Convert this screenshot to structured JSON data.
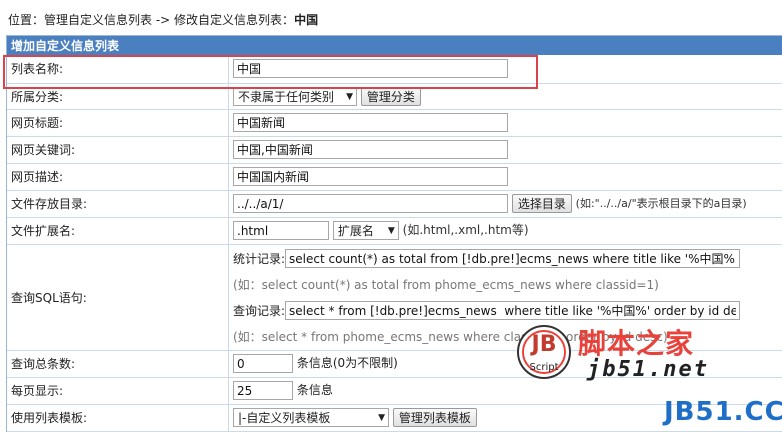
{
  "breadcrumb": {
    "prefix": "位置：",
    "link1": "管理自定义信息列表",
    "sep": " -> ",
    "current_prefix": "修改自定义信息列表：",
    "current_name": "中国"
  },
  "panel_title": "增加自定义信息列表",
  "form": {
    "list_name": {
      "label": "列表名称:",
      "value": "中国"
    },
    "category": {
      "label": "所属分类:",
      "selected": "不隶属于任何类别",
      "button": "管理分类"
    },
    "page_title": {
      "label": "网页标题:",
      "value": "中国新闻"
    },
    "keywords": {
      "label": "网页关键词:",
      "value": "中国,中国新闻"
    },
    "description": {
      "label": "网页描述:",
      "value": "中国国内新闻"
    },
    "directory": {
      "label": "文件存放目录:",
      "value": "../../a/1/",
      "button": "选择目录",
      "hint": "(如:\"../../a/\"表示根目录下的a目录)"
    },
    "extension": {
      "label": "文件扩展名:",
      "value": ".html",
      "selected": "扩展名",
      "hint": "(如.html,.xml,.htm等)"
    },
    "sql": {
      "label": "查询SQL语句:",
      "count_label": "统计记录:",
      "count_value": "select count(*) as total from [!db.pre!]ecms_news where title like '%中国%'",
      "count_hint": "(如：select count(*) as total from phome_ecms_news where classid=1)",
      "query_label": "查询记录:",
      "query_value": "select * from [!db.pre!]ecms_news  where title like '%中国%' order by id desc",
      "query_hint": "(如：select * from phome_ecms_news where classid=1 order by id desc)"
    },
    "total": {
      "label": "查询总条数:",
      "value": "0",
      "unit": "条信息(0为不限制)"
    },
    "per_page": {
      "label": "每页显示:",
      "value": "25",
      "unit": "条信息"
    },
    "template": {
      "label": "使用列表模板:",
      "selected": "|-自定义列表模板",
      "button": "管理列表模板"
    }
  },
  "watermark": {
    "badge_letters": "JB",
    "badge_sub": "Script",
    "site_cn": "脚本之家",
    "site_url": "jb51.net",
    "corner": "JB51.CC"
  },
  "colors": {
    "header_bg": "#4a7fc0",
    "highlight": "#d9434b",
    "watermark_red": "#e8423b",
    "watermark_blue": "#1f6fc8"
  }
}
